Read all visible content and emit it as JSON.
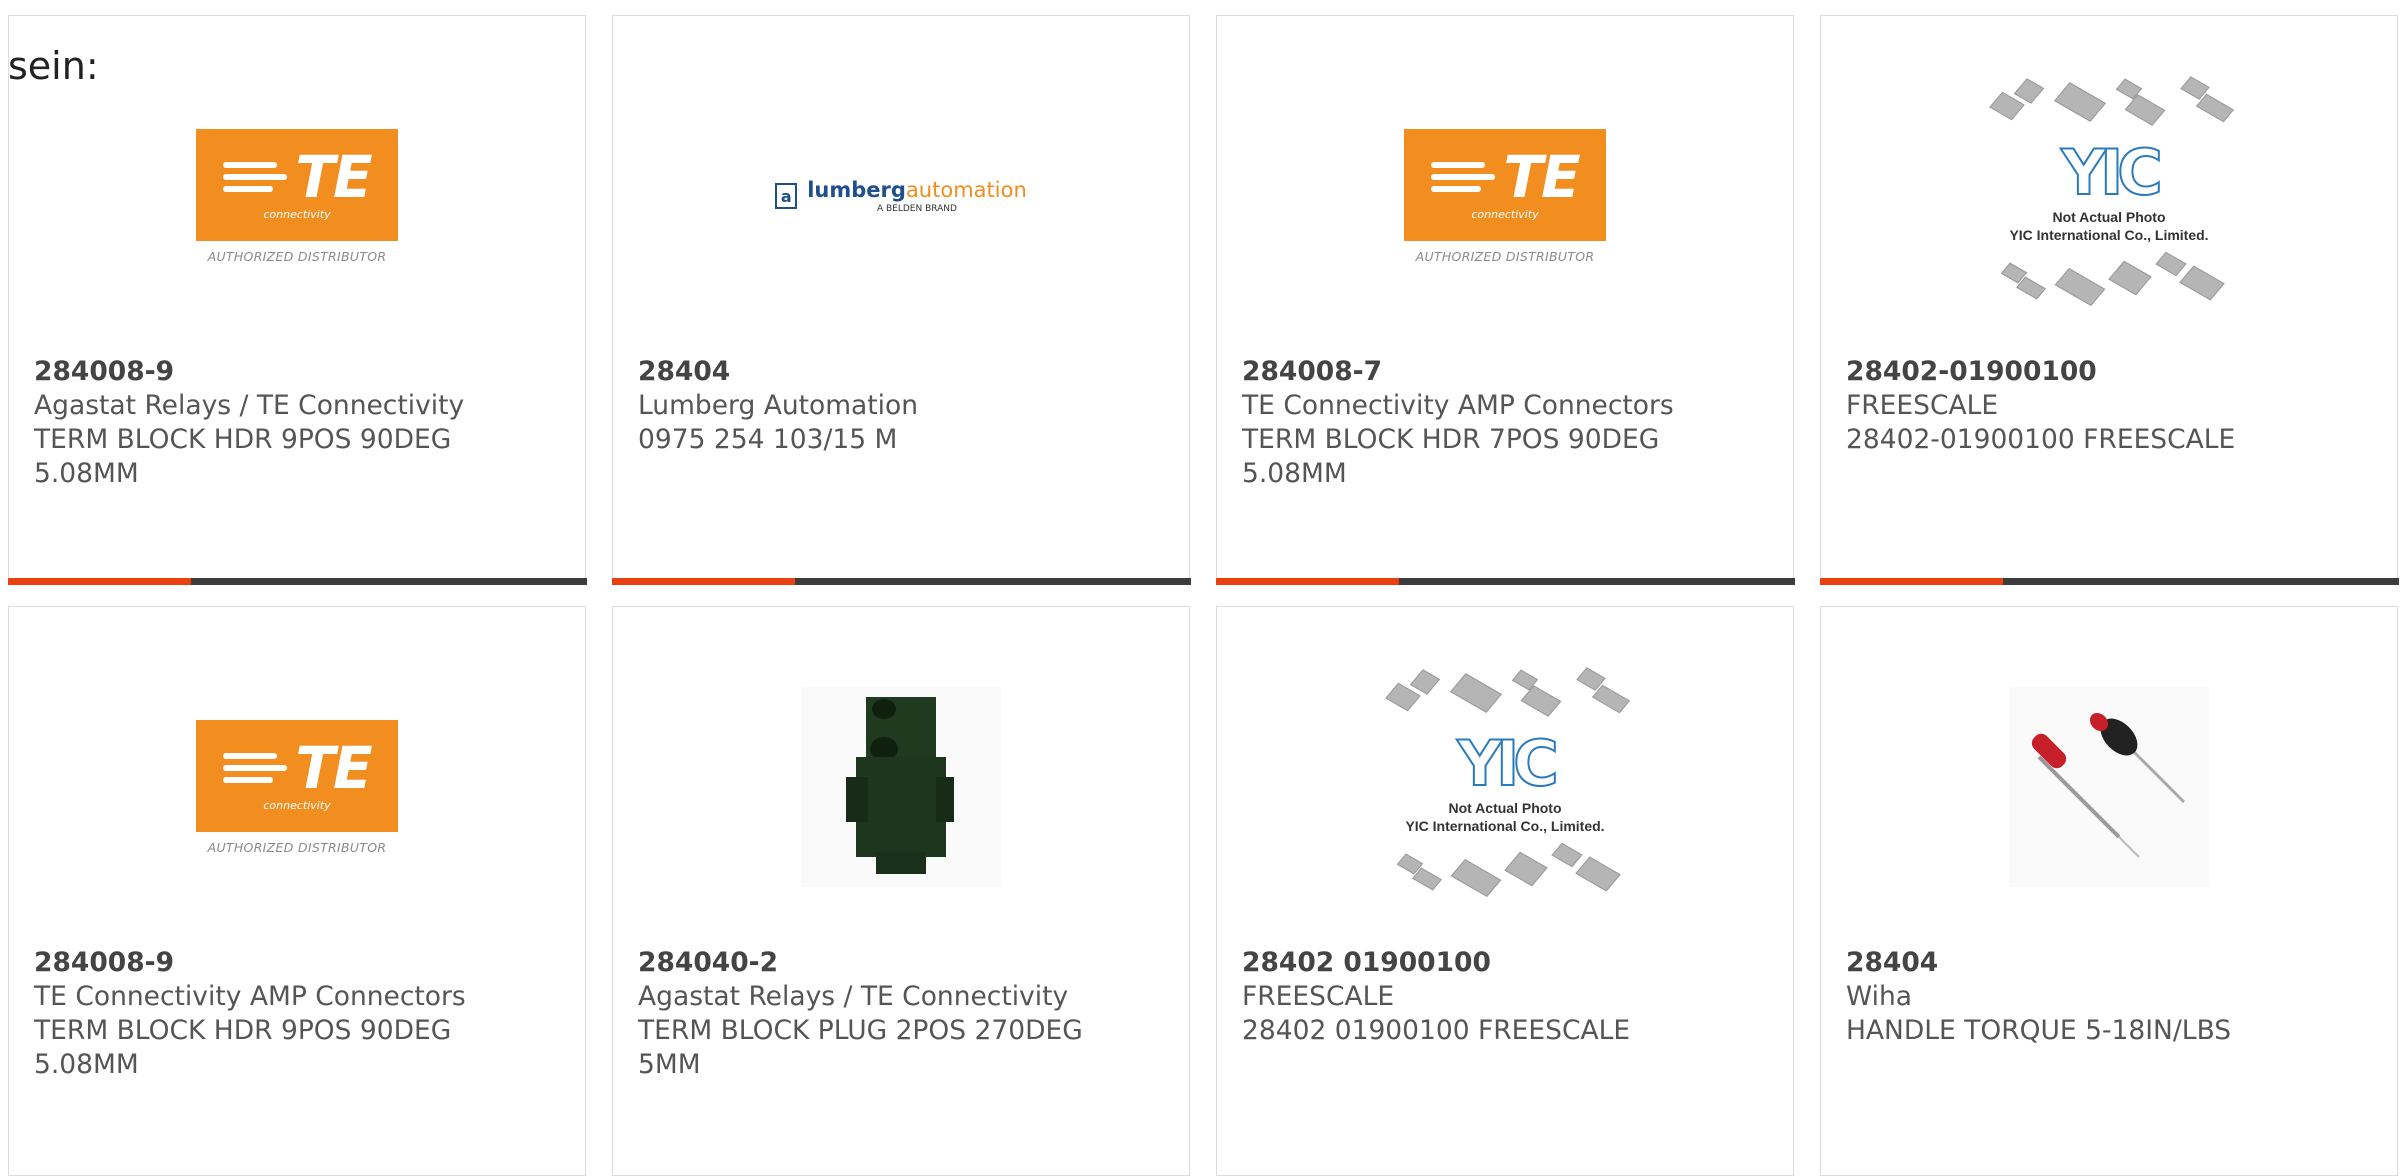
{
  "intro_text": "sein:",
  "brand_colors": {
    "accent": "#e8410f",
    "bar": "#3c3c3c",
    "te_orange": "#f28e1f",
    "lumberg_blue": "#1f4f8c",
    "yic_blue": "#2a7bbd"
  },
  "te_logo": {
    "mark": "TE",
    "sub": "connectivity",
    "authorized": "AUTHORIZED DISTRIBUTOR"
  },
  "lumberg_logo": {
    "name_a": "lumberg",
    "name_b": "automation",
    "tag": "A BELDEN BRAND",
    "glyph": "a"
  },
  "yic_logo": {
    "mark": "YIC",
    "note_line1": "Not Actual Photo",
    "note_line2": "YIC International Co., Limited."
  },
  "products": [
    {
      "part": "284008-9",
      "manufacturer": "Agastat Relays / TE Connectivity",
      "desc1": "TERM BLOCK HDR 9POS 90DEG",
      "desc2": "5.08MM",
      "image": "te-logo"
    },
    {
      "part": "28404",
      "manufacturer": "Lumberg Automation",
      "desc1": "0975 254 103/15 M",
      "desc2": "",
      "image": "lumberg-logo"
    },
    {
      "part": "284008-7",
      "manufacturer": "TE Connectivity AMP Connectors",
      "desc1": "TERM BLOCK HDR 7POS 90DEG",
      "desc2": "5.08MM",
      "image": "te-logo"
    },
    {
      "part": "28402-01900100",
      "manufacturer": "FREESCALE",
      "desc1": "28402-01900100 FREESCALE",
      "desc2": "",
      "image": "yic-placeholder"
    },
    {
      "part": "284008-9",
      "manufacturer": "TE Connectivity AMP Connectors",
      "desc1": "TERM BLOCK HDR 9POS 90DEG",
      "desc2": "5.08MM",
      "image": "te-logo"
    },
    {
      "part": "284040-2",
      "manufacturer": "Agastat Relays / TE Connectivity",
      "desc1": "TERM BLOCK PLUG 2POS 270DEG",
      "desc2": "5MM",
      "image": "terminal-block-photo"
    },
    {
      "part": "28402 01900100",
      "manufacturer": "FREESCALE",
      "desc1": "28402 01900100 FREESCALE",
      "desc2": "",
      "image": "yic-placeholder"
    },
    {
      "part": "28404",
      "manufacturer": "Wiha",
      "desc1": "HANDLE TORQUE 5-18IN/LBS",
      "desc2": "",
      "image": "screwdriver-photo"
    }
  ]
}
